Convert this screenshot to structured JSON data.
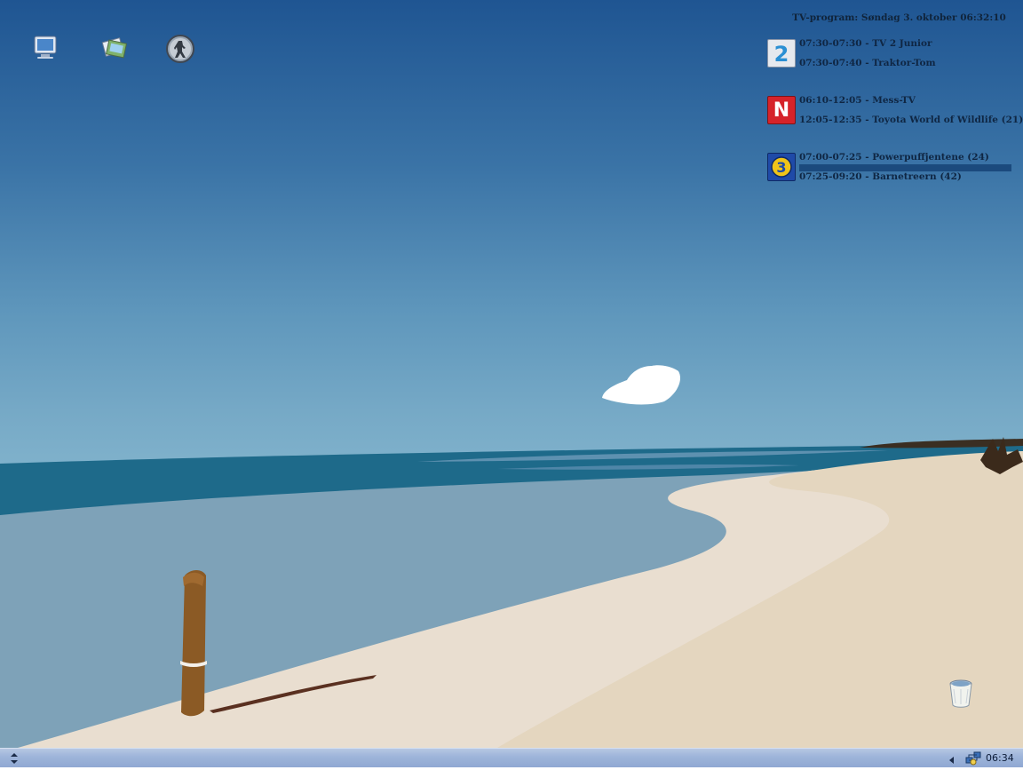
{
  "desktop": {
    "icons": [
      {
        "name": "my-computer"
      },
      {
        "name": "photos"
      },
      {
        "name": "counter-strike"
      }
    ]
  },
  "tv_widget": {
    "title": "TV-program: Søndag 3. oktober 06:32:10",
    "channels": [
      {
        "logo": "2",
        "programs": [
          "07:30-07:30 - TV 2 Junior",
          "07:30-07:40 - Traktor-Tom"
        ]
      },
      {
        "logo": "N",
        "programs": [
          "06:10-12:05 - Mess-TV",
          "12:05-12:35 - Toyota World of Wildlife (21)"
        ]
      },
      {
        "logo": "3",
        "programs": [
          "07:00-07:25 - Powerpuffjentene (24)",
          "07:25-09:20 - Barnetreern (42)"
        ],
        "progress": 1.0
      }
    ]
  },
  "taskbar": {
    "clock": "06:34"
  },
  "colors": {
    "tv2_red": "#e23b2f",
    "nrk_red": "#d6232a",
    "tv3_blue": "#1f4aa8",
    "tv3_yellow": "#f0c419"
  }
}
